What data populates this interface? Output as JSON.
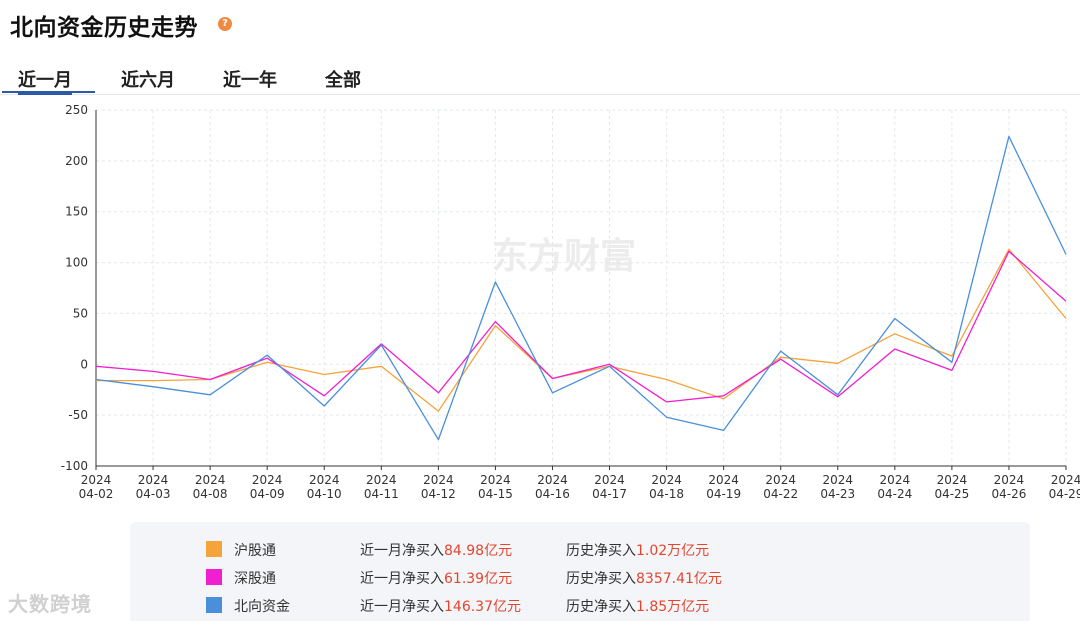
{
  "header": {
    "title": "北向资金历史走势",
    "help_icon": "question-icon"
  },
  "tabs": [
    {
      "label": "近一月",
      "active": true
    },
    {
      "label": "近六月",
      "active": false
    },
    {
      "label": "近一年",
      "active": false
    },
    {
      "label": "全部",
      "active": false
    }
  ],
  "chart_data": {
    "type": "line",
    "watermark": "东方财富",
    "x": [
      "2024\n04-02",
      "2024\n04-03",
      "2024\n04-08",
      "2024\n04-09",
      "2024\n04-10",
      "2024\n04-11",
      "2024\n04-12",
      "2024\n04-15",
      "2024\n04-16",
      "2024\n04-17",
      "2024\n04-18",
      "2024\n04-19",
      "2024\n04-22",
      "2024\n04-23",
      "2024\n04-24",
      "2024\n04-25",
      "2024\n04-26",
      "2024\n04-29"
    ],
    "ylim": [
      -100,
      250
    ],
    "yticks": [
      250,
      200,
      150,
      100,
      50,
      0,
      -50,
      -100
    ],
    "grid": true,
    "series": [
      {
        "name": "沪股通",
        "color": "#f5a33b",
        "values": [
          -16,
          -16,
          -15,
          2,
          -10,
          -2,
          -46,
          38,
          -14,
          -2,
          -15,
          -34,
          7,
          1,
          30,
          8,
          113,
          45
        ]
      },
      {
        "name": "深股通",
        "color": "#f01fd0",
        "values": [
          -2,
          -7,
          -15,
          6,
          -31,
          20,
          -28,
          42,
          -14,
          0,
          -37,
          -31,
          5,
          -32,
          15,
          -6,
          111,
          62
        ]
      },
      {
        "name": "北向资金",
        "color": "#4a8fdb",
        "values": [
          -15,
          -22,
          -30,
          9,
          -41,
          19,
          -74,
          81,
          -28,
          -2,
          -52,
          -65,
          13,
          -30,
          45,
          2,
          224,
          108
        ]
      }
    ]
  },
  "legend": [
    {
      "name": "沪股通",
      "color": "#f5a33b",
      "recent_label": "近一月净买入",
      "recent_value": "84.98亿元",
      "hist_label": "历史净买入",
      "hist_value": "1.02万亿元"
    },
    {
      "name": "深股通",
      "color": "#f01fd0",
      "recent_label": "近一月净买入",
      "recent_value": "61.39亿元",
      "hist_label": "历史净买入",
      "hist_value": "8357.41亿元"
    },
    {
      "name": "北向资金",
      "color": "#4a8fdb",
      "recent_label": "近一月净买入",
      "recent_value": "146.37亿元",
      "hist_label": "历史净买入",
      "hist_value": "1.85万亿元"
    }
  ],
  "footer_watermark": "大数跨境"
}
